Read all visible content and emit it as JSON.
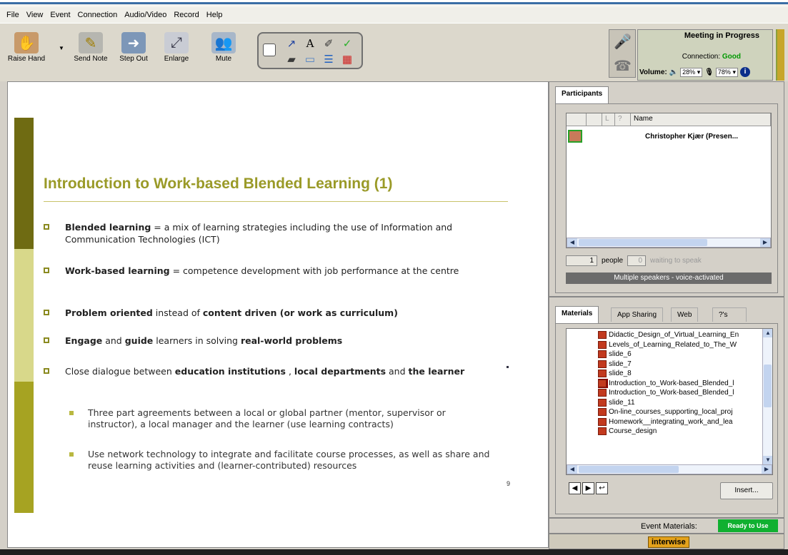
{
  "menu": [
    "File",
    "View",
    "Event",
    "Connection",
    "Audio/Video",
    "Record",
    "Help"
  ],
  "toolbar": {
    "raise_hand": "Raise Hand",
    "send_note": "Send Note",
    "step_out": "Step Out",
    "enlarge": "Enlarge",
    "mute": "Mute"
  },
  "status": {
    "title": "Meeting in Progress",
    "connection_label": "Connection:",
    "connection_value": "Good",
    "volume_label": "Volume:",
    "speaker_volume": "28%",
    "mic_volume": "78%"
  },
  "slide": {
    "title": "Introduction to Work-based Blended Learning (1)",
    "bullets": [
      {
        "lead": "Blended learning",
        "rest": " = a mix of learning strategies including the use of Information and Communication Technologies (ICT)"
      },
      {
        "lead": "Work-based learning",
        "rest": " = competence development with job performance at the centre"
      },
      {
        "a": "Problem oriented",
        "b": " instead of ",
        "c": "content driven (or work as curriculum)"
      },
      {
        "a": "Engage",
        "b": " and ",
        "c": "guide",
        "d": " learners in solving ",
        "e": "real-world problems"
      },
      {
        "a": "Close dialogue between ",
        "b": "education institutions",
        "c": " , ",
        "d": "local departments",
        "e": " and ",
        "f": "the learner"
      }
    ],
    "sub_bullets": [
      "Three part agreements between a local or global partner (mentor, supervisor or instructor), a local manager and the learner (use learning contracts)",
      "Use network technology to integrate and facilitate course processes, as well as share and reuse learning activities and (learner-contributed) resources"
    ],
    "page_number": "9"
  },
  "participants": {
    "tab": "Participants",
    "header_name": "Name",
    "header_col3": "?",
    "rows": [
      {
        "name": "Christopher Kjær (Presen..."
      }
    ],
    "people_count": "1",
    "people_label": "people",
    "waiting_count": "0",
    "waiting_label": "waiting to speak",
    "speaker_mode": "Multiple speakers - voice-activated"
  },
  "materials": {
    "tabs": [
      "Materials",
      "App Sharing",
      "Web",
      "?'s"
    ],
    "items": [
      "Didactic_Design_of_Virtual_Learning_En",
      "Levels_of_Learning_Related_to_The_W",
      "slide_6",
      "slide_7",
      "slide_8",
      "Introduction_to_Work-based_Blended_l",
      "Introduction_to_Work-based_Blended_l",
      "slide_11",
      "On-line_courses_supporting_local_proj",
      "Homework__integrating_work_and_lea",
      "Course_design"
    ],
    "selected_index": 5,
    "insert_label": "Insert..."
  },
  "footer": {
    "event_materials": "Event Materials:",
    "ready": "Ready to Use",
    "brand": "interwise"
  }
}
